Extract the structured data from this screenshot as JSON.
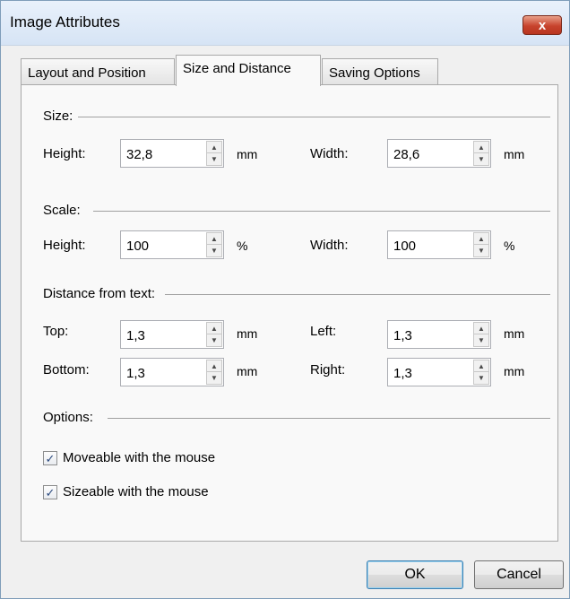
{
  "window": {
    "title": "Image Attributes",
    "close_glyph": "x"
  },
  "tabs": [
    {
      "label": "Layout and Position",
      "active": false
    },
    {
      "label": "Size and Distance",
      "active": true
    },
    {
      "label": "Saving Options",
      "active": false
    }
  ],
  "size": {
    "label": "Size:",
    "height_label": "Height:",
    "height_value": "32,8",
    "height_unit": "mm",
    "width_label": "Width:",
    "width_value": "28,6",
    "width_unit": "mm"
  },
  "scale": {
    "label": "Scale:",
    "height_label": "Height:",
    "height_value": "100",
    "height_unit": "%",
    "width_label": "Width:",
    "width_value": "100",
    "width_unit": "%"
  },
  "distance": {
    "label": "Distance from text:",
    "top_label": "Top:",
    "top_value": "1,3",
    "top_unit": "mm",
    "left_label": "Left:",
    "left_value": "1,3",
    "left_unit": "mm",
    "bottom_label": "Bottom:",
    "bottom_value": "1,3",
    "bottom_unit": "mm",
    "right_label": "Right:",
    "right_value": "1,3",
    "right_unit": "mm"
  },
  "options": {
    "label": "Options:",
    "moveable_label": "Moveable with the mouse",
    "moveable_checked": true,
    "sizeable_label": "Sizeable with the mouse",
    "sizeable_checked": true
  },
  "buttons": {
    "ok": "OK",
    "cancel": "Cancel"
  },
  "icons": {
    "spin_up": "▲",
    "spin_down": "▼",
    "check": "✓"
  },
  "colors": {
    "titlebar": "#d6e4f5",
    "close_button": "#c7432d",
    "panel": "#f9f9f9"
  }
}
